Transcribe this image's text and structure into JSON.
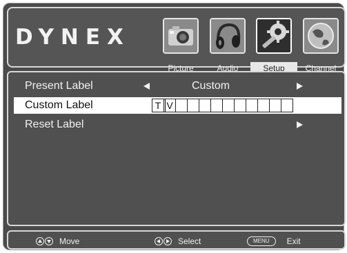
{
  "brand": {
    "logo_text": "DYNEX"
  },
  "tabs": [
    {
      "label": "Picture",
      "icon": "camera-icon",
      "active": false
    },
    {
      "label": "Audio",
      "icon": "headphones-icon",
      "active": false
    },
    {
      "label": "Setup",
      "icon": "gear-icon",
      "active": true
    },
    {
      "label": "Channel",
      "icon": "globe-icon",
      "active": false
    }
  ],
  "settings": {
    "present_label": {
      "label": "Present Label",
      "value": "Custom"
    },
    "custom_label": {
      "label": "Custom Label",
      "chars": [
        "T",
        "V",
        "",
        "",
        "",
        "",
        "",
        "",
        "",
        "",
        "",
        ""
      ]
    },
    "reset_label": {
      "label": "Reset Label"
    }
  },
  "footer": {
    "move": "Move",
    "select": "Select",
    "menu_button": "MENU",
    "exit": "Exit"
  },
  "colors": {
    "background": "#4a4a4a",
    "selected_row": "#ffffff",
    "text": "#f2f2f2"
  }
}
